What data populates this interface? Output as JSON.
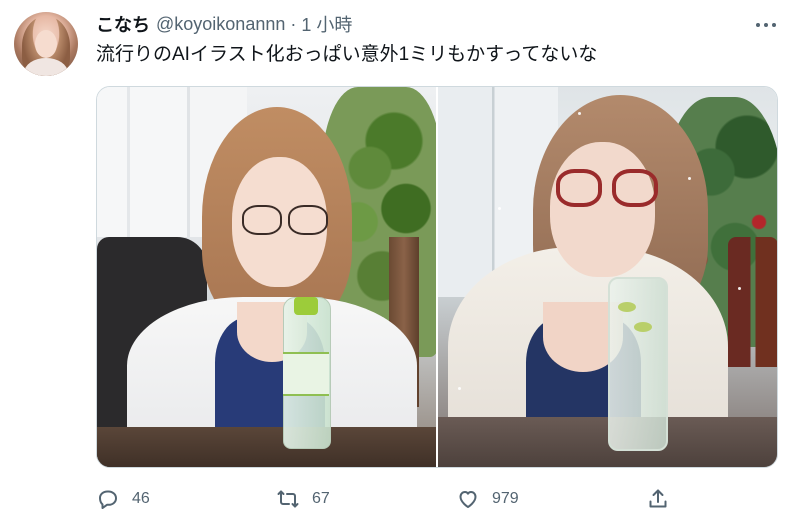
{
  "tweet": {
    "author": {
      "display_name": "こなち",
      "handle": "@koyoikonannn",
      "avatar_icon": "user-avatar"
    },
    "separator": "·",
    "time": "1 小時",
    "text": "流行りのAIイラスト化おっぱい意外1ミリもかすってないな",
    "more_icon": "more-horizontal-icon",
    "media": [
      {
        "kind": "photo",
        "subject": "original-photo"
      },
      {
        "kind": "photo",
        "subject": "ai-illustration"
      }
    ],
    "actions": {
      "reply": {
        "icon": "reply-icon",
        "count": "46"
      },
      "retweet": {
        "icon": "retweet-icon",
        "count": "67"
      },
      "like": {
        "icon": "heart-icon",
        "count": "979"
      },
      "share": {
        "icon": "share-icon",
        "count": ""
      }
    }
  },
  "colors": {
    "text_primary": "#0f1419",
    "text_secondary": "#536471",
    "border": "#cfd9de",
    "background": "#ffffff"
  }
}
